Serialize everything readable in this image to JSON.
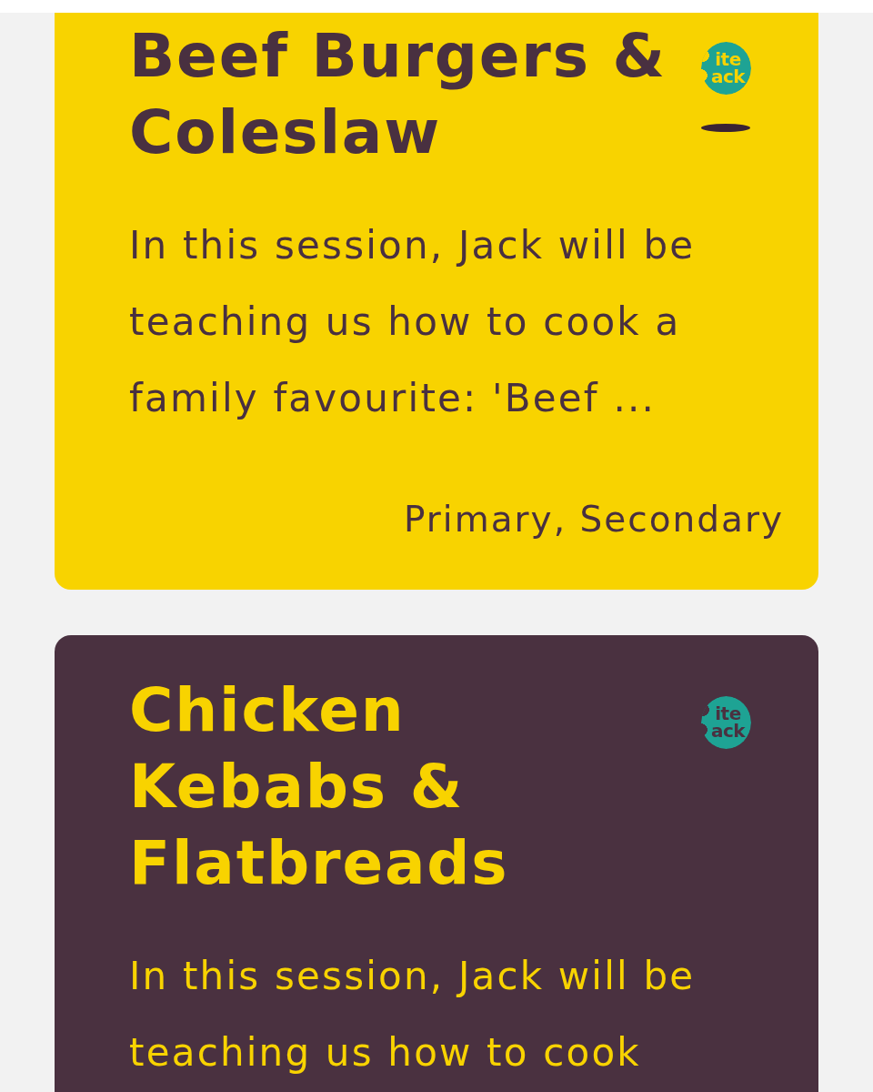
{
  "cards": [
    {
      "kind": "light",
      "color": "#f8d300",
      "title": "Beef Burgers & Coleslaw",
      "description": "In this session, Jack will be teaching us how to cook a family favourite: 'Beef ...",
      "tags": "Primary, Secondary",
      "logo": {
        "lines": [
          "ite",
          "ack"
        ]
      },
      "logo_shadow": true
    },
    {
      "kind": "dark",
      "color": "#4a3140",
      "title": "Chicken Kebabs & Flatbreads",
      "description": "In this session, Jack will be teaching us how to cook",
      "logo": {
        "lines": [
          "ite",
          "ack"
        ]
      },
      "logo_shadow": false
    }
  ]
}
